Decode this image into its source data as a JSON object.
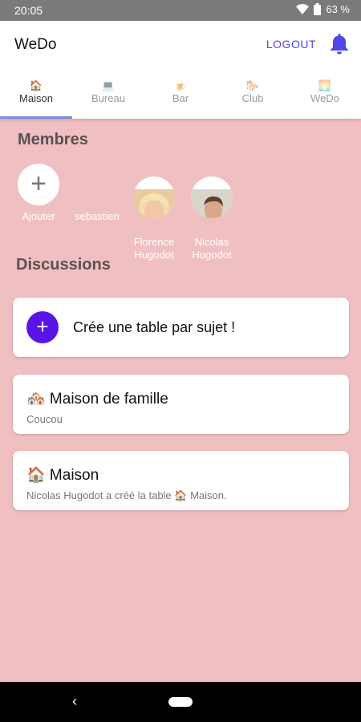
{
  "status": {
    "time": "20:05",
    "battery": "63 %"
  },
  "appbar": {
    "title": "WeDo",
    "logout": "LOGOUT"
  },
  "tabs": [
    {
      "icon": "🏠",
      "label": "Maison"
    },
    {
      "icon": "💻",
      "label": "Bureau"
    },
    {
      "icon": "🍺",
      "label": "Bar"
    },
    {
      "icon": "🐎",
      "label": "Club"
    },
    {
      "icon": "🌅",
      "label": "WeDo"
    }
  ],
  "members_title": "Membres",
  "members": [
    {
      "name": "Ajouter",
      "icon": "plus"
    },
    {
      "name": "sebastien"
    },
    {
      "name": "Florence\nHugodot"
    },
    {
      "name": "Nicolas\nHugodot"
    }
  ],
  "discussions_title": "Discussions",
  "create_card": {
    "icon": "+",
    "label": "Crée une table par sujet !"
  },
  "tables": [
    {
      "title": "🏘️ Maison de famille",
      "subtitle": "Coucou"
    },
    {
      "title": "🏠 Maison",
      "subtitle": "Nicolas Hugodot a créé la table 🏠 Maison."
    }
  ],
  "nav": {
    "back": "‹"
  },
  "colors": {
    "accent": "#4f46e5",
    "fab": "#5b12e8",
    "background": "#f0bfc1"
  }
}
